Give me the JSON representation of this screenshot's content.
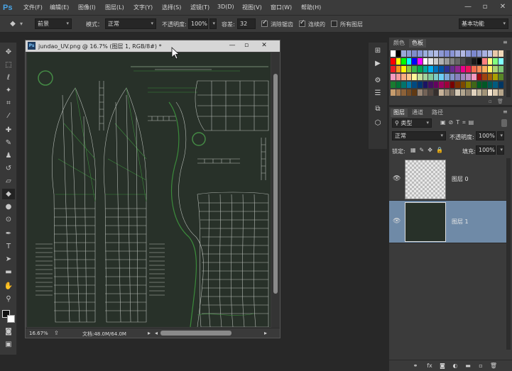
{
  "app": {
    "logo": "Ps"
  },
  "menu": [
    "文件(F)",
    "编辑(E)",
    "图像(I)",
    "图层(L)",
    "文字(Y)",
    "选择(S)",
    "滤镜(T)",
    "3D(D)",
    "视图(V)",
    "窗口(W)",
    "帮助(H)"
  ],
  "window_controls": {
    "minimize": "—",
    "restore": "▫",
    "close": "✕"
  },
  "options": {
    "tool_preset": "前景",
    "mode_label": "模式：",
    "mode_value": "正常",
    "opacity_label": "不透明度:",
    "opacity_value": "100%",
    "tolerance_label": "容差:",
    "tolerance_value": "32",
    "antialias_label": "消除锯齿",
    "antialias_checked": true,
    "contiguous_label": "连续的",
    "contiguous_checked": true,
    "all_layers_label": "所有图层",
    "all_layers_checked": false,
    "workspace": "基本功能"
  },
  "document": {
    "title": "jundao_UV.png @ 16.7% (图层 1, RGB/8#) *",
    "icon": "Ps",
    "zoom": "16.67%",
    "doc_size": "文档:48.0M/64.0M"
  },
  "swatches_panel": {
    "tabs": [
      "颜色",
      "色板"
    ],
    "active_tab": "色板",
    "row0": [
      "#ffffff",
      "#000000",
      "#9aa8d8",
      "#8c9ad2",
      "#7f8ccb",
      "#8796d6",
      "#9aaedc",
      "#a4b4e0",
      "#b0bce6",
      "#8c98d4",
      "#7f8ad0",
      "#8a94d6",
      "#a0a8dc",
      "#b2b8e2",
      "#8f9bd8",
      "#7c88cf",
      "#8a96d4",
      "#a8b0e0",
      "#bac2e8",
      "#e8c8a8",
      "#f0d8b8"
    ],
    "rows": [
      [
        "#ff0000",
        "#ffff00",
        "#00ff00",
        "#00ffff",
        "#0000ff",
        "#ff00ff",
        "#ffffff",
        "#e6e6e6",
        "#cccccc",
        "#b3b3b3",
        "#999999",
        "#808080",
        "#666666",
        "#4d4d4d",
        "#333333",
        "#1a1a1a",
        "#000000",
        "#ff8080",
        "#ffff80",
        "#80ff80",
        "#80ffff"
      ],
      [
        "#ed1c24",
        "#f7941d",
        "#fff200",
        "#8dc63f",
        "#39b54a",
        "#00a651",
        "#00a99d",
        "#00aeef",
        "#0072bc",
        "#0054a6",
        "#2e3192",
        "#662d91",
        "#92278f",
        "#ec008c",
        "#ed145b",
        "#f26c4f",
        "#f68e56",
        "#fbaf5d",
        "#fff568",
        "#acd373",
        "#7cc576"
      ],
      [
        "#f49ac1",
        "#f6989d",
        "#f9ad81",
        "#fdc68a",
        "#fff799",
        "#c4df9b",
        "#a3d39c",
        "#82ca9c",
        "#7accc8",
        "#6dcff6",
        "#7da7d9",
        "#8393ca",
        "#8781bd",
        "#a186be",
        "#bd8cbf",
        "#f49ac2",
        "#9e0b0f",
        "#a0410d",
        "#a36209",
        "#aba000",
        "#598527"
      ],
      [
        "#197b30",
        "#007236",
        "#00746b",
        "#0076a3",
        "#004a80",
        "#003471",
        "#1b1464",
        "#440e62",
        "#630460",
        "#9e005d",
        "#9e0039",
        "#790000",
        "#7b2e00",
        "#7d4900",
        "#827b00",
        "#406618",
        "#005e20",
        "#005826",
        "#005952",
        "#005b7f",
        "#003663"
      ],
      [
        "#c69c6d",
        "#a67c52",
        "#8c6239",
        "#754c24",
        "#603913",
        "#998675",
        "#736357",
        "#534741",
        "#362f2d",
        "#c7b299",
        "#9a8a78",
        "#7b6e60",
        "#d5c9b6",
        "#b3a68f",
        "#8f8270",
        "#e0d2bd",
        "#c2b59b",
        "#a29478",
        "#f5e6d0",
        "#d9c8ad",
        "#b6a58a"
      ]
    ]
  },
  "layers_panel": {
    "tabs": [
      "图层",
      "通道",
      "路径"
    ],
    "active_tab": "图层",
    "filter_kind": "类型",
    "blend_mode": "正常",
    "opacity_label": "不透明度:",
    "opacity_value": "100%",
    "lock_label": "锁定:",
    "fill_label": "填充:",
    "fill_value": "100%",
    "layers": [
      {
        "name": "图层 0",
        "visible": true,
        "selected": false,
        "thumb": "transparent-checker"
      },
      {
        "name": "图层 1",
        "visible": true,
        "selected": true,
        "thumb": "dark-fill"
      }
    ]
  },
  "colors": {
    "canvas_bg": "#283129",
    "wire_white": "#cfd4cf",
    "wire_green": "#3f9a3f",
    "selection_blue": "#6f8aa7"
  }
}
